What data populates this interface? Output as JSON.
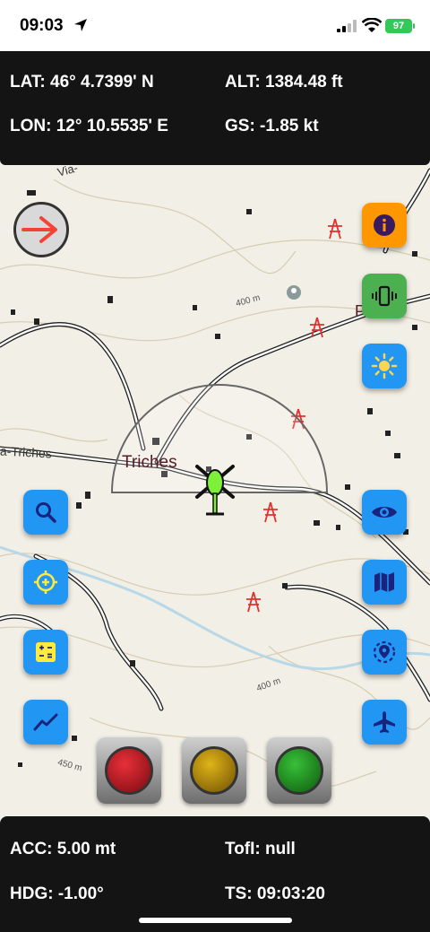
{
  "status": {
    "time": "09:03",
    "battery": "97"
  },
  "telemetry_top": {
    "lat": "LAT: 46° 4.7399' N",
    "alt": "ALT: 1384.48 ft",
    "lon": "LON: 12° 10.5535' E",
    "gs": "GS: -1.85 kt"
  },
  "telemetry_bottom": {
    "acc": "ACC: 5.00 mt",
    "tofl": "TofI: null",
    "hdg": "HDG: -1.00°",
    "ts": "TS: 09:03:20"
  },
  "map": {
    "labels": {
      "triches": "Triches",
      "via_triches": "a-Triches",
      "via_top": "Via-",
      "place_right": "Prates",
      "c400a": "400 m",
      "c400b": "400 m",
      "c450": "450 m"
    }
  },
  "buttons": {
    "info": "info-icon",
    "vibrate": "vibration-icon",
    "brightness": "brightness-icon",
    "search": "search-icon",
    "locate": "locate-icon",
    "calculator": "calculator-icon",
    "chart": "chart-icon",
    "visibility": "eye-icon",
    "map": "map-icon",
    "location": "location-icon",
    "airplane": "airplane-icon"
  },
  "traffic_lights": {
    "red": "#c0101a",
    "yellow": "#c49a0a",
    "green": "#1f9c1f"
  },
  "colors": {
    "fab_blue": "#2196f3",
    "fab_orange": "#ff9800",
    "fab_green": "#4caf50",
    "panel": "#141414"
  }
}
